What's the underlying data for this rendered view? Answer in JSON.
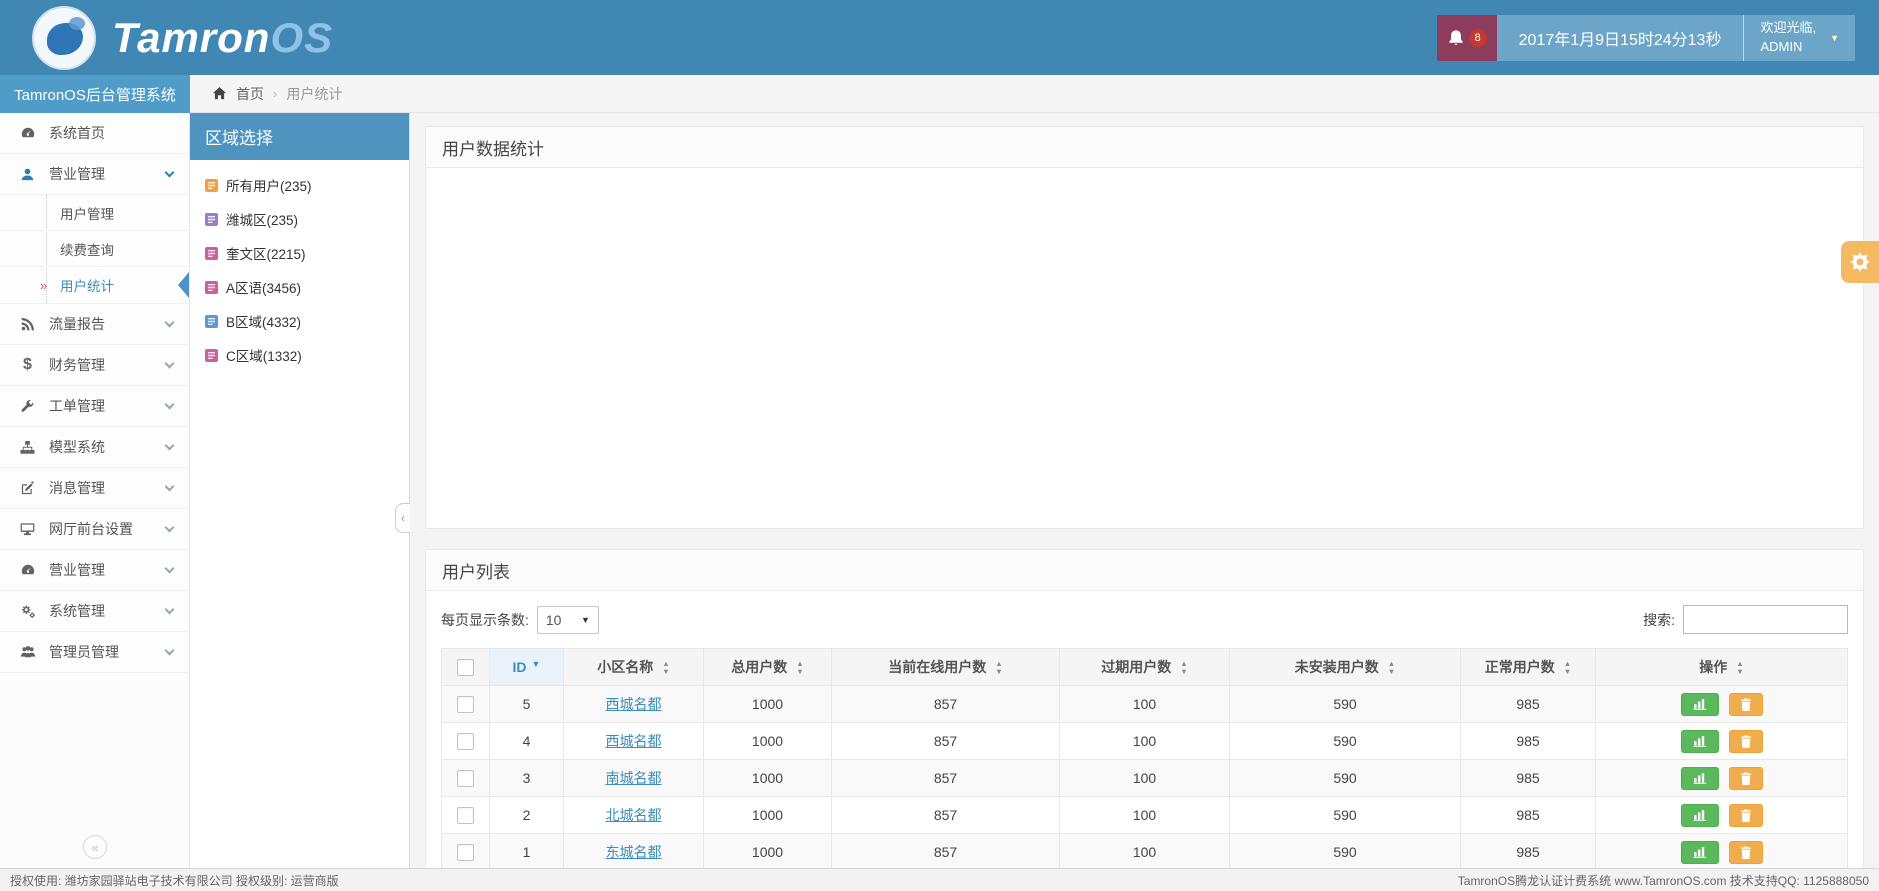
{
  "app": {
    "logo_text": "Tamron",
    "logo_accent": "OS"
  },
  "topbar": {
    "notification_count": "8",
    "datetime": "2017年1月9日15时24分13秒",
    "welcome_greeting": "欢迎光临,",
    "welcome_user": "ADMIN"
  },
  "sidebar": {
    "title": "TamronOS后台管理系统",
    "active_marker": "»",
    "items": [
      {
        "label": "系统首页",
        "icon": "dashboard-icon"
      },
      {
        "label": "营业管理",
        "icon": "user-icon",
        "expanded": true,
        "children": [
          {
            "label": "用户管理"
          },
          {
            "label": "续费查询"
          },
          {
            "label": "用户统计",
            "active": true
          }
        ]
      },
      {
        "label": "流量报告",
        "icon": "rss-icon"
      },
      {
        "label": "财务管理",
        "icon": "dollar-icon"
      },
      {
        "label": "工单管理",
        "icon": "wrench-icon"
      },
      {
        "label": "模型系统",
        "icon": "sitemap-icon"
      },
      {
        "label": "消息管理",
        "icon": "edit-icon"
      },
      {
        "label": "网厅前台设置",
        "icon": "desktop-icon"
      },
      {
        "label": "营业管理",
        "icon": "dashboard-icon"
      },
      {
        "label": "系统管理",
        "icon": "gears-icon"
      },
      {
        "label": "管理员管理",
        "icon": "users-icon"
      }
    ]
  },
  "breadcrumb": {
    "home_label": "首页",
    "separator": "›",
    "current": "用户统计"
  },
  "region_panel": {
    "title": "区域选择",
    "items": [
      {
        "label": "所有用户(235)",
        "color": "#f5a03c"
      },
      {
        "label": "潍城区(235)",
        "color": "#9b7cc9"
      },
      {
        "label": "奎文区(2215)",
        "color": "#ce5f9e"
      },
      {
        "label": "A区语(3456)",
        "color": "#ce5f9e"
      },
      {
        "label": "B区域(4332)",
        "color": "#5a9bd4"
      },
      {
        "label": "C区域(1332)",
        "color": "#ce5f9e"
      }
    ]
  },
  "stats_panel": {
    "title": "用户数据统计"
  },
  "list_panel": {
    "title": "用户列表",
    "per_page_label": "每页显示条数:",
    "per_page_value": "10",
    "search_label": "搜索:",
    "table": {
      "columns": [
        "ID",
        "小区名称",
        "总用户数",
        "当前在线用户数",
        "过期用户数",
        "未安装用户数",
        "正常用户数",
        "操作"
      ],
      "rows": [
        {
          "id": "5",
          "name": "西城名都",
          "total": "1000",
          "online": "857",
          "expired": "100",
          "uninstalled": "590",
          "normal": "985"
        },
        {
          "id": "4",
          "name": "西城名都",
          "total": "1000",
          "online": "857",
          "expired": "100",
          "uninstalled": "590",
          "normal": "985"
        },
        {
          "id": "3",
          "name": "南城名都",
          "total": "1000",
          "online": "857",
          "expired": "100",
          "uninstalled": "590",
          "normal": "985"
        },
        {
          "id": "2",
          "name": "北城名都",
          "total": "1000",
          "online": "857",
          "expired": "100",
          "uninstalled": "590",
          "normal": "985"
        },
        {
          "id": "1",
          "name": "东城名都",
          "total": "1000",
          "online": "857",
          "expired": "100",
          "uninstalled": "590",
          "normal": "985"
        }
      ]
    }
  },
  "footer": {
    "left": "授权使用: 潍坊家园驿站电子技术有限公司  授权级别: 运营商版",
    "right": "TamronOS腾龙认证计费系统 www.TamronOS.com 技术支持QQ: 1125888050"
  },
  "icons": {
    "dollar": "$",
    "caret_down": "▼",
    "sort_asc": "▲",
    "sort_desc": "▼",
    "collapse_left": "‹",
    "collapse_circle": "«"
  },
  "colors": {
    "topbar": "#4187b3",
    "panel_header_blue": "#4f94bf",
    "accent_orange": "#f0ad4e",
    "accent_green": "#5cb85c",
    "link": "#3c8dbc",
    "notification_bg": "#8e3c5e"
  }
}
